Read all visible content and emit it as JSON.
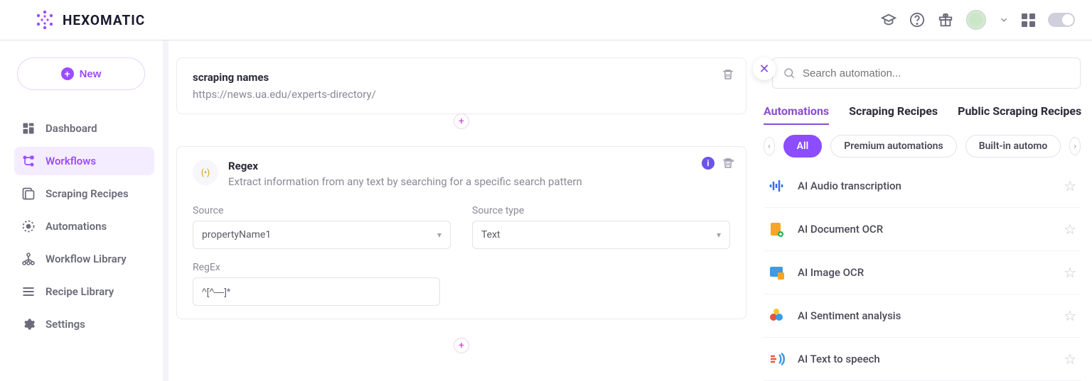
{
  "brand": "HEXOMATIC",
  "newButton": "New",
  "nav": {
    "dashboard": "Dashboard",
    "workflows": "Workflows",
    "scrapingRecipes": "Scraping Recipes",
    "automations": "Automations",
    "workflowLibrary": "Workflow Library",
    "recipeLibrary": "Recipe Library",
    "settings": "Settings"
  },
  "step1": {
    "title": "scraping names",
    "url": "https://news.ua.edu/experts-directory/"
  },
  "regex": {
    "title": "Regex",
    "desc": "Extract information from any text by searching for a specific search pattern",
    "sourceLabel": "Source",
    "sourceValue": "propertyName1",
    "sourceTypeLabel": "Source type",
    "sourceTypeValue": "Text",
    "regexLabel": "RegEx",
    "regexValue": "^[^—]*"
  },
  "panel": {
    "searchPlaceholder": "Search automation...",
    "tabs": {
      "auto": "Automations",
      "scr": "Scraping Recipes",
      "pub": "Public Scraping Recipes"
    },
    "chips": {
      "all": "All",
      "premium": "Premium automations",
      "builtin": "Built-in automo"
    },
    "items": {
      "audio": "AI Audio transcription",
      "docOcr": "AI Document OCR",
      "imgOcr": "AI Image OCR",
      "sentiment": "AI Sentiment analysis",
      "tts": "AI Text to speech"
    }
  }
}
